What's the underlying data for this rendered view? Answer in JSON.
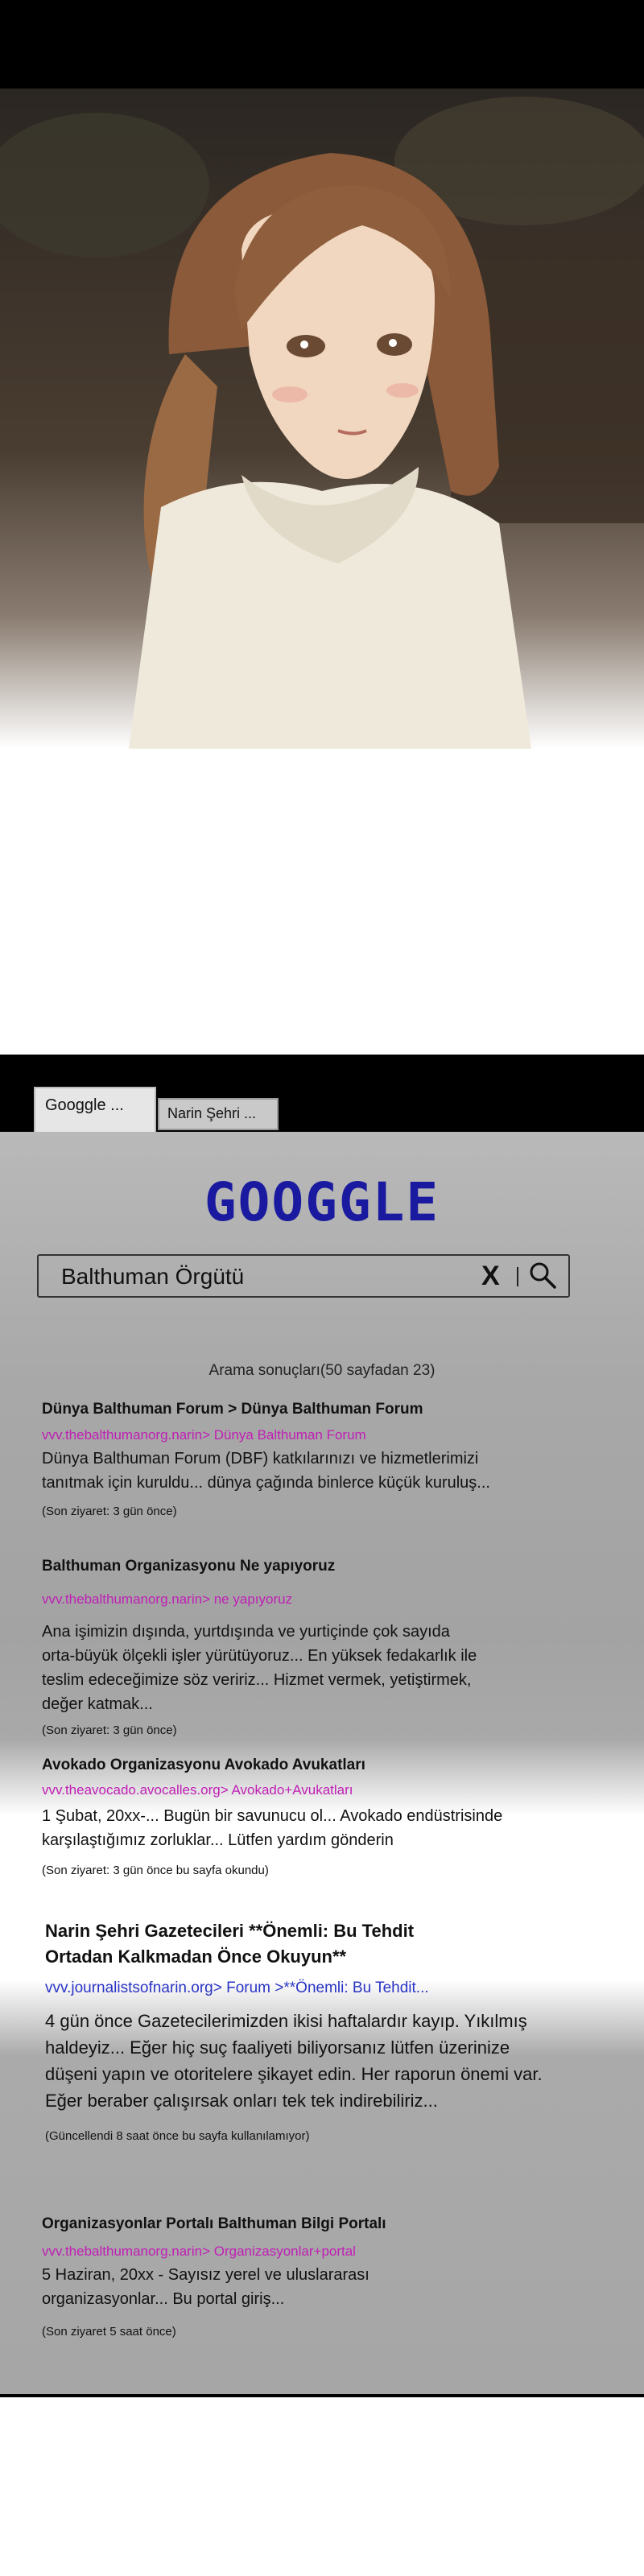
{
  "browser": {
    "tabs": [
      {
        "label": "Googgle ..."
      },
      {
        "label": "Narin Şehri ..."
      }
    ],
    "logo": "GOOGGLE",
    "search": {
      "value": "Balthuman Örgütü",
      "clear_label": "X"
    },
    "result_count": "Arama sonuçları(50 sayfadan 23)",
    "results": [
      {
        "title": "Dünya Balthuman Forum > Dünya Balthuman Forum",
        "url": "vvv.thebalthumanorg.narin> Dünya Balthuman Forum",
        "snippet": [
          "Dünya Balthuman Forum (DBF) katkılarınızı ve hizmetlerimizi",
          "tanıtmak için kuruldu... dünya çağında binlerce küçük kuruluş..."
        ],
        "meta": "(Son ziyaret: 3 gün önce)"
      },
      {
        "title": "Balthuman Organizasyonu Ne yapıyoruz",
        "url": "vvv.thebalthumanorg.narin> ne yapıyoruz",
        "snippet": [
          "Ana işimizin dışında, yurtdışında ve yurtiçinde çok sayıda",
          "orta-büyük ölçekli işler yürütüyoruz... En yüksek fedakarlık ile",
          "teslim edeceğimize söz veririz... Hizmet vermek, yetiştirmek,",
          "değer katmak..."
        ],
        "meta": "(Son ziyaret: 3 gün önce)"
      },
      {
        "title": "Avokado Organizasyonu Avokado Avukatları",
        "url": "vvv.theavocado.avocalles.org> Avokado+Avukatları",
        "snippet": [
          "1 Şubat, 20xx-... Bugün bir savunucu ol... Avokado endüstrisinde",
          "karşılaştığımız zorluklar... Lütfen yardım gönderin"
        ],
        "meta": "(Son ziyaret: 3 gün önce bu sayfa okundu)"
      },
      {
        "title": [
          "Narin Şehri Gazetecileri **Önemli: Bu Tehdit",
          "Ortadan Kalkmadan Önce Okuyun**"
        ],
        "url": "vvv.journalistsofnarin.org> Forum >**Önemli: Bu Tehdit...",
        "snippet": [
          "4 gün önce Gazetecilerimizden ikisi haftalardır kayıp. Yıkılmış",
          "haldeyiz... Eğer hiç suç faaliyeti biliyorsanız lütfen üzerinize",
          "düşeni yapın ve otoritelere şikayet edin. Her raporun önemi var.",
          "Eğer beraber çalışırsak onları tek tek indirebiliriz..."
        ],
        "meta": "(Güncellendi 8 saat önce bu sayfa kullanılamıyor)"
      },
      {
        "title": "Organizasyonlar Portalı Balthuman Bilgi Portalı",
        "url": "vvv.thebalthumanorg.narin> Organizasyonlar+portal",
        "snippet": [
          "5 Haziran, 20xx - Sayısız yerel ve uluslararası",
          "organizasyonlar... Bu portal giriş..."
        ],
        "meta": "(Son ziyaret 5 saat önce)"
      }
    ]
  },
  "colors": {
    "logo": "#1a1aa0",
    "url_pink": "#c01fb5",
    "url_blue": "#2a35c5",
    "background_gray": "#a8a8a8"
  }
}
